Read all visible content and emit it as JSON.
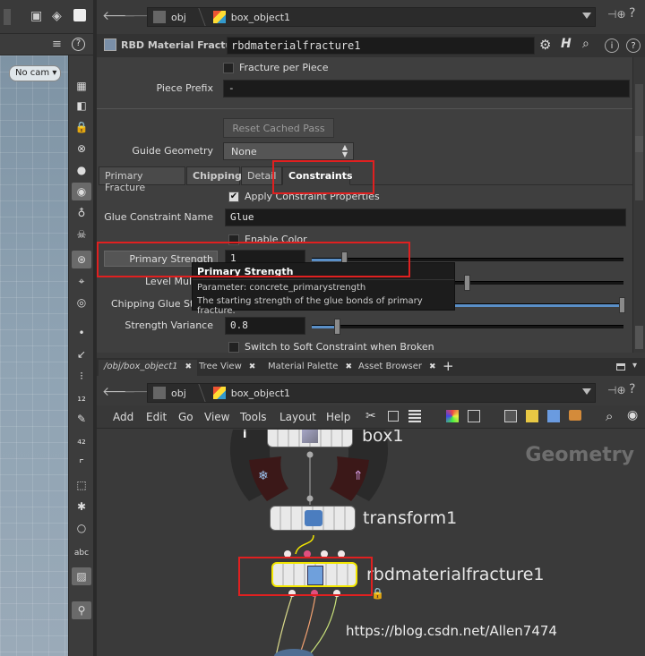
{
  "viewport": {
    "camera_label": "No cam"
  },
  "nav": {
    "path_root": "obj",
    "path_object": "box_object1"
  },
  "node_header": {
    "type_label": "RBD Material Fracture",
    "node_name": "rbdmaterialfracture1",
    "icons": [
      "gear-icon",
      "help-h-icon",
      "search-icon",
      "info-icon",
      "help-icon"
    ]
  },
  "params": {
    "fracture_per_piece": "Fracture per Piece",
    "piece_prefix_label": "Piece Prefix",
    "piece_prefix_value": "-",
    "reset_button": "Reset Cached Pass",
    "guide_geometry_label": "Guide Geometry",
    "guide_geometry_value": "None",
    "tabs": [
      "Primary Fracture",
      "Chipping",
      "Detail",
      "Constraints"
    ],
    "active_tab": "Constraints",
    "apply_constraint": "Apply Constraint Properties",
    "glue_name_label": "Glue Constraint Name",
    "glue_name_value": "Glue",
    "enable_color": "Enable Color",
    "primary_strength_label": "Primary Strength",
    "primary_strength_value": "1",
    "level_mult_label": "Level Mult",
    "chipping_glue_label": "Chipping Glue Stre",
    "strength_variance_label": "Strength Variance",
    "strength_variance_value": "0.8",
    "soft_constraint": "Switch to Soft Constraint when Broken"
  },
  "tooltip": {
    "title": "Primary Strength",
    "line1": "Parameter: concrete_primarystrength",
    "line2": "The starting strength of the glue bonds of primary fracture."
  },
  "pane_tabs": [
    "/obj/box_object1",
    "Tree View",
    "Material Palette",
    "Asset Browser"
  ],
  "menus": [
    "Add",
    "Edit",
    "Go",
    "View",
    "Tools",
    "Layout",
    "Help"
  ],
  "network": {
    "context_label": "Geometry",
    "nodes": [
      "box1",
      "transform1",
      "rbdmaterialfracture1"
    ]
  },
  "watermark": "https://blog.csdn.net/Allen7474",
  "colors": {
    "highlight": "#e02020",
    "selected_node": "#f2e600",
    "slider_fill": "#5a8fc7"
  }
}
